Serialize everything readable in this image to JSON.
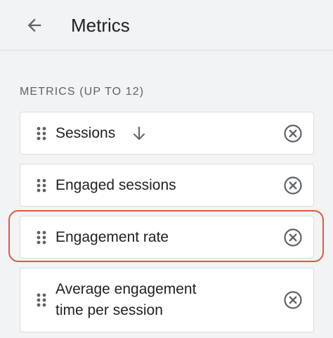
{
  "header": {
    "title": "Metrics"
  },
  "section": {
    "label": "METRICS (UP TO 12)"
  },
  "metrics": [
    {
      "label": "Sessions",
      "sorted": "descending"
    },
    {
      "label": "Engaged sessions"
    },
    {
      "label": "Engagement rate",
      "highlighted": true
    },
    {
      "label_line1": "Average engagement",
      "label_line2": "time per session"
    }
  ],
  "colors": {
    "background": "#f1f3f4",
    "card": "#ffffff",
    "border": "#dadce0",
    "text": "#202124",
    "muted": "#5f6368",
    "highlight": "#e8553f"
  },
  "icons": {
    "back": "arrow-left-icon",
    "drag": "drag-handle-icon",
    "remove": "remove-circle-x-icon",
    "sort": "arrow-down-icon"
  }
}
